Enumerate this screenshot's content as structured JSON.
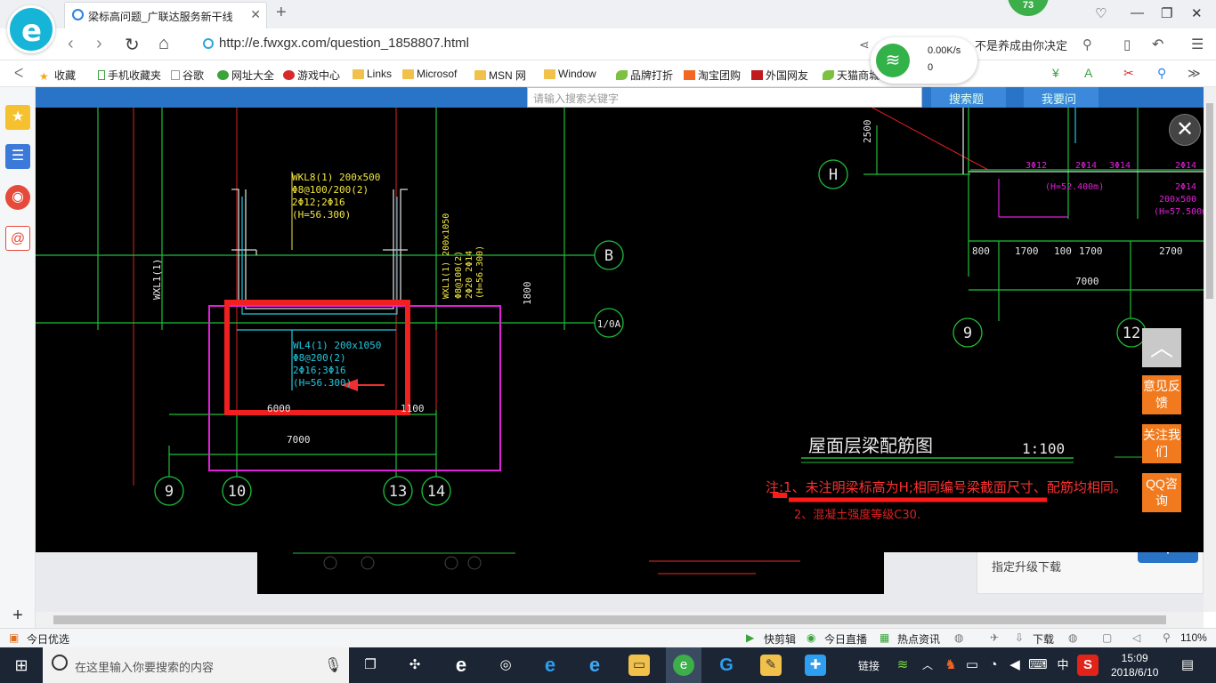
{
  "browser": {
    "tab_title": "梁标高问题_广联达服务新干线",
    "badge_count": "73",
    "url": "http://e.fwxgx.com/question_1858807.html",
    "search_hint": "不是养成由你决定",
    "net_speed": "0.00K/s",
    "net_count": "0"
  },
  "bookmarks": [
    "收藏",
    "手机收藏夹",
    "谷歌",
    "网址大全",
    "游戏中心",
    "Links",
    "Microsof",
    "MSN 网",
    "Window",
    "品牌打折",
    "淘宝团购",
    "外国网友",
    "天猫商城"
  ],
  "page_bg": {
    "search_placeholder": "请输入搜索关键字",
    "search_button": "搜索题",
    "ask_button": "我要问",
    "download_text": "指定升级下载"
  },
  "cad": {
    "beam_top": [
      "WKL8(1) 200x500",
      "Φ8@100/200(2)",
      "2Φ12;2Φ16",
      "(H=56.300)"
    ],
    "beam_main": [
      "WL4(1) 200x1050",
      "Φ8@200(2)",
      "2Φ16;3Φ16",
      "(H=56.300)"
    ],
    "beam_side": [
      "WXL1(1) 200x1050",
      "Φ8@100(2)",
      "2Φ20 2Φ14",
      "(H=56.300)"
    ],
    "beam_left": "WXL1(1)",
    "dim_6000": "6000",
    "dim_1100": "1100",
    "dim_7000": "7000",
    "dim_1800": "1800",
    "dim_2500": "2500",
    "axes": [
      "B",
      "1/0A",
      "H",
      "9",
      "10",
      "13",
      "14",
      "9",
      "12"
    ],
    "right_dims": [
      "800",
      "1700",
      "100",
      "1700",
      "2700"
    ],
    "right_total": "7000",
    "right_labels": [
      "(H=52.400m)",
      "2Φ14",
      "200x500",
      "(H=57.500m)",
      "3Φ12",
      "2Φ14",
      "3Φ14",
      "2Φ14"
    ],
    "drawing_title": "屋面层梁配筋图",
    "drawing_scale": "1:100",
    "note_1": "注:1、未注明梁标高为H;相同编号梁截面尺寸、配筋均相同。",
    "note_2": "2、混凝土强度等级C30."
  },
  "right_buttons": [
    "意见反馈",
    "关注我们",
    "QQ咨询"
  ],
  "statusbar": {
    "left": "今日优选",
    "items": [
      "快剪辑",
      "今日直播",
      "热点资讯",
      "下载"
    ],
    "zoom": "110%"
  },
  "taskbar": {
    "search_placeholder": "在这里输入你要搜索的内容",
    "link_label": "链接",
    "ime": "中",
    "time": "15:09",
    "date": "2018/6/10"
  }
}
